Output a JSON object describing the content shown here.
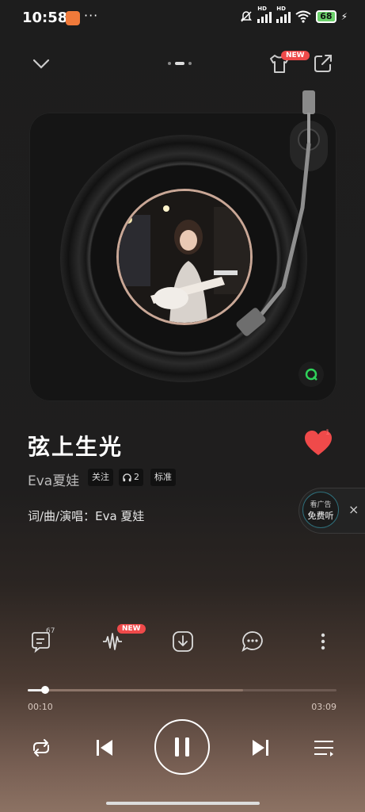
{
  "status_bar": {
    "time": "10:58",
    "more": "···",
    "hd1": "HD",
    "hd2": "HD",
    "battery": "68"
  },
  "player": {
    "pager_pages": 3,
    "pager_active": 2,
    "new_badge": "NEW"
  },
  "song": {
    "title": "弦上生光",
    "artist": "Eva夏娃",
    "follow_tag": "关注",
    "listen_count": "2",
    "quality_tag": "标准",
    "credits": "词/曲/演唱：Eva 夏娃",
    "liked_count": "1"
  },
  "ad": {
    "line1": "看广告",
    "line2": "免费听",
    "close": "×"
  },
  "actions": {
    "comment_count": "67",
    "new_badge": "NEW"
  },
  "progress": {
    "current": "00:10",
    "total": "03:09",
    "played_fraction": 0.053
  },
  "colors": {
    "accent_red": "#ef4a4a",
    "qq_green": "#2fd25a"
  }
}
